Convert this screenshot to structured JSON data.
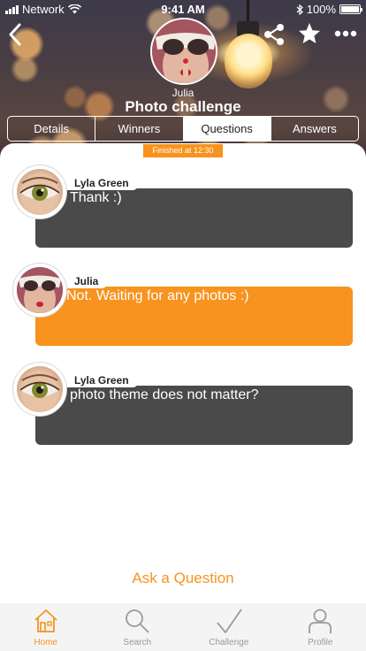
{
  "status_bar": {
    "carrier": "Network",
    "time": "9:41 AM",
    "battery": "100%",
    "battery_level": 1.0
  },
  "header": {
    "creator_name": "Julia",
    "title": "Photo challenge",
    "icons": {
      "back": "chevron-left-icon",
      "share": "share-icon",
      "favorite": "star-icon",
      "more": "more-dots-icon"
    }
  },
  "tabs": [
    {
      "label": "Details",
      "active": false
    },
    {
      "label": "Winners",
      "active": false
    },
    {
      "label": "Questions",
      "active": true
    },
    {
      "label": "Answers",
      "active": false
    }
  ],
  "finished_badge": "Finished at 12:30",
  "messages": [
    {
      "author": "Lyla Green",
      "text": "Thank :)",
      "style": "dark",
      "avatar": "eye-photo"
    },
    {
      "author": "Julia",
      "text": "Not. Waiting for any photos :)",
      "style": "orange",
      "avatar": "sunglasses-photo"
    },
    {
      "author": "Lyla Green",
      "text": "photo theme does not matter?",
      "style": "dark",
      "avatar": "eye-photo"
    }
  ],
  "ask_question_label": "Ask a Question",
  "tabbar": [
    {
      "label": "Home",
      "icon": "home-icon",
      "active": true
    },
    {
      "label": "Search",
      "icon": "search-icon",
      "active": false
    },
    {
      "label": "Challenge",
      "icon": "checkmark-icon",
      "active": false
    },
    {
      "label": "Profile",
      "icon": "person-icon",
      "active": false
    }
  ],
  "colors": {
    "accent": "#f7931e",
    "bubble_dark": "#4a4a4a",
    "tab_inactive": "#999999"
  }
}
